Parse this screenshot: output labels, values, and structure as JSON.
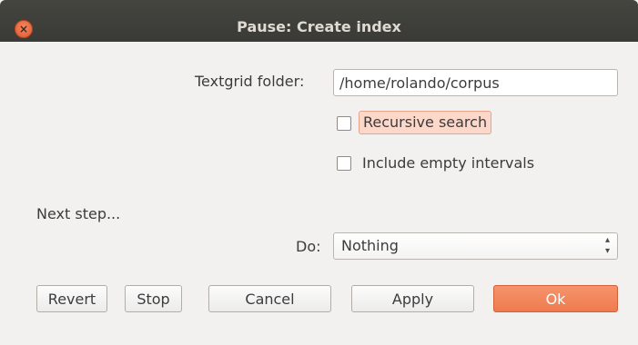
{
  "window": {
    "title": "Pause: Create index",
    "close_glyph": "×"
  },
  "form": {
    "textgrid_label": "Textgrid folder:",
    "textgrid_value": "/home/rolando/corpus",
    "recursive_label": "Recursive search",
    "recursive_checked": false,
    "include_empty_label": "Include empty intervals",
    "include_empty_checked": false,
    "next_step_label": "Next step...",
    "do_label": "Do:",
    "do_selected": "Nothing"
  },
  "buttons": {
    "revert": "Revert",
    "stop": "Stop",
    "cancel": "Cancel",
    "apply": "Apply",
    "ok": "Ok"
  },
  "colors": {
    "accent": "#ef7b4f",
    "titlebar": "#3c3b37",
    "background": "#f2f1f0"
  },
  "icons": {
    "close": "close-icon",
    "select_arrows": "up-down-arrows-icon"
  }
}
